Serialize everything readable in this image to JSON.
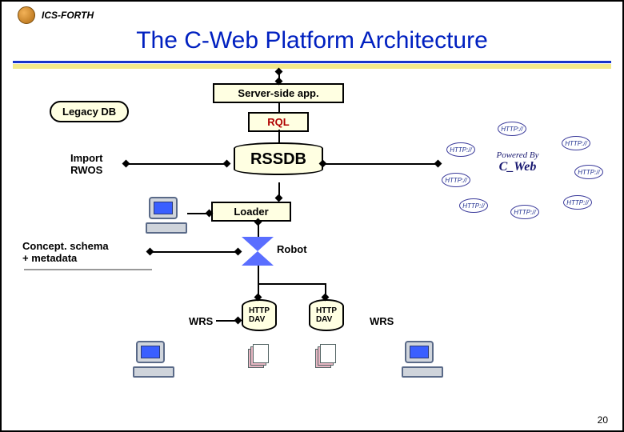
{
  "brand": "ICS-FORTH",
  "title": "The C-Web Platform Architecture",
  "slide_number": "20",
  "nodes": {
    "server_side_app": "Server-side app.",
    "legacy_db": "Legacy DB",
    "rql": "RQL",
    "import_rwos": "Import\nRWOS",
    "rssdb": "RSSDB",
    "loader": "Loader",
    "concept_schema": "Concept. schema\n+ metadata",
    "robot": "Robot",
    "wrs_left": "WRS",
    "wrs_right": "WRS",
    "http_dav_1": "HTTP\nDAV",
    "http_dav_2": "HTTP\nDAV"
  },
  "cweb_logo": {
    "line1": "Powered By",
    "line2": "C_Web"
  },
  "satellites": {
    "label": "HTTP://"
  }
}
